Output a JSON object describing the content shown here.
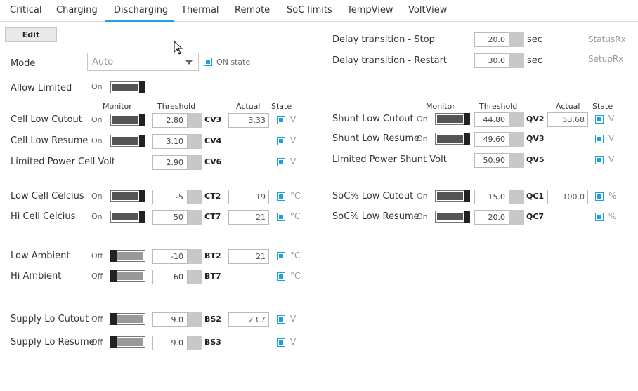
{
  "tabs": [
    "Critical",
    "Charging",
    "Discharging",
    "Thermal",
    "Remote",
    "SoC limits",
    "TempView",
    "VoltView"
  ],
  "active_tab": "Discharging",
  "accent_color": "#1ba1e2",
  "edit_label": "Edit",
  "mode": {
    "label": "Mode",
    "value": "Auto",
    "on_state_label": "ON state"
  },
  "allow_limited": {
    "label": "Allow Limited",
    "state": "On"
  },
  "headers": {
    "monitor": "Monitor",
    "threshold": "Threshold",
    "actual": "Actual",
    "state": "State"
  },
  "delay": {
    "stop": {
      "label": "Delay transition - Stop",
      "value": "20.0",
      "unit": "sec",
      "rx": "StatusRx"
    },
    "restart": {
      "label": "Delay transition - Restart",
      "value": "30.0",
      "unit": "sec",
      "rx": "SetupRx"
    }
  },
  "left_rows": [
    {
      "label": "Cell Low Cutout",
      "monitor": "On",
      "threshold": "2.80",
      "code": "CV3",
      "actual": "3.33",
      "unit": "V"
    },
    {
      "label": "Cell Low Resume",
      "monitor": "On",
      "threshold": "3.10",
      "code": "CV4",
      "actual": "",
      "unit": "V"
    },
    {
      "label": "Limited Power Cell Volt",
      "monitor": "",
      "threshold": "2.90",
      "code": "CV6",
      "actual": "",
      "unit": "V"
    },
    {
      "label": "Low Cell Celcius",
      "monitor": "On",
      "threshold": "-5",
      "code": "CT2",
      "actual": "19",
      "unit": "°C"
    },
    {
      "label": "Hi Cell Celcius",
      "monitor": "On",
      "threshold": "50",
      "code": "CT7",
      "actual": "21",
      "unit": "°C"
    },
    {
      "label": "Low Ambient",
      "monitor": "Off",
      "threshold": "-10",
      "code": "BT2",
      "actual": "21",
      "unit": "°C"
    },
    {
      "label": "Hi Ambient",
      "monitor": "Off",
      "threshold": "60",
      "code": "BT7",
      "actual": "",
      "unit": "°C"
    },
    {
      "label": "Supply Lo Cutout",
      "monitor": "Off",
      "threshold": "9.0",
      "code": "BS2",
      "actual": "23.7",
      "unit": "V"
    },
    {
      "label": "Supply Lo Resume",
      "monitor": "Off",
      "threshold": "9.0",
      "code": "BS3",
      "actual": "",
      "unit": "V"
    }
  ],
  "right_rows": [
    {
      "label": "Shunt Low Cutout",
      "monitor": "On",
      "threshold": "44.80",
      "code": "QV2",
      "actual": "53.68",
      "unit": "V"
    },
    {
      "label": "Shunt Low Resume",
      "monitor": "On",
      "threshold": "49.60",
      "code": "QV3",
      "actual": "",
      "unit": "V"
    },
    {
      "label": "Limited Power Shunt Volt",
      "monitor": "",
      "threshold": "50.90",
      "code": "QV5",
      "actual": "",
      "unit": "V"
    },
    {
      "label": "SoC% Low Cutout",
      "monitor": "On",
      "threshold": "15.0",
      "code": "QC1",
      "actual": "100.0",
      "unit": "%"
    },
    {
      "label": "SoC% Low Resume",
      "monitor": "On",
      "threshold": "20.0",
      "code": "QC7",
      "actual": "",
      "unit": "%"
    }
  ]
}
